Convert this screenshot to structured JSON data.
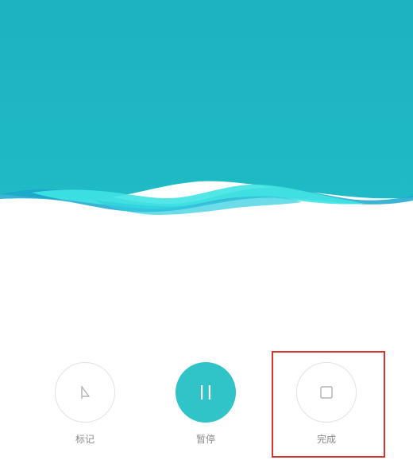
{
  "recorder": {
    "wave_colors": {
      "background": "#1eb6c2",
      "light": "#3ee0e4",
      "mid": "#2ec9d6",
      "deep": "#1aa8c8"
    },
    "controls": {
      "mark": {
        "label": "标记",
        "icon": "flag-icon"
      },
      "pause": {
        "label": "暂停",
        "icon": "pause-icon",
        "color": "#30c4c8"
      },
      "done": {
        "label": "完成",
        "icon": "stop-icon"
      }
    },
    "highlight_color": "#d9332e"
  }
}
